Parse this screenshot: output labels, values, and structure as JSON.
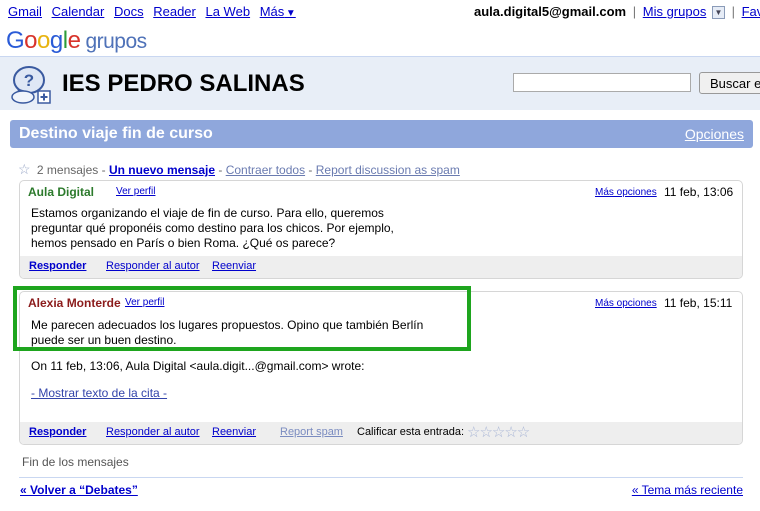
{
  "topnav": {
    "links": [
      "Gmail",
      "Calendar",
      "Docs",
      "Reader",
      "La Web",
      "Más"
    ],
    "more_caret": "▼",
    "user_email": "aula.digital5@gmail.com",
    "sep": "|",
    "mis_grupos": "Mis grupos",
    "dropdown_glyph": "▼",
    "favoritos": "Favo"
  },
  "logo": {
    "letters": [
      "G",
      "o",
      "o",
      "g",
      "l",
      "e"
    ],
    "product": "grupos"
  },
  "group": {
    "title": "IES PEDRO SALINAS",
    "search_placeholder": "",
    "search_button": "Buscar e"
  },
  "topic": {
    "title": "Destino viaje fin de curso",
    "options": "Opciones"
  },
  "actions": {
    "star_glyph": "☆",
    "count": "2 mensajes",
    "sep": "-",
    "new_message": "Un nuevo mensaje",
    "collapse_all": "Contraer todos",
    "report_spam": "Report discussion as spam"
  },
  "messages": [
    {
      "author": "Aula Digital",
      "ver_perfil": "Ver perfil",
      "mas_opciones": "Más opciones",
      "date": "11 feb, 13:06",
      "body_lines": [
        "Estamos organizando el viaje de fin de curso. Para ello, queremos",
        "preguntar qué proponéis como destino para los chicos. Por ejemplo,",
        "hemos pensado en París o bien Roma. ¿Qué os parece?"
      ],
      "footer": {
        "reply": "Responder",
        "reply_author": "Responder al autor",
        "forward": "Reenviar"
      }
    },
    {
      "author": "Alexia Monterde",
      "ver_perfil": "Ver perfil",
      "mas_opciones": "Más opciones",
      "date": "11 feb, 15:11",
      "body_lines": [
        "Me parecen adecuados los lugares propuestos. Opino que también Berlín",
        "puede ser un buen destino."
      ],
      "quote_header": "On 11 feb, 13:06, Aula Digital <aula.digit...@gmail.com> wrote:",
      "show_quote": "- Mostrar texto de la cita -",
      "footer": {
        "reply": "Responder",
        "reply_author": "Responder al autor",
        "forward": "Reenviar",
        "report_spam": "Report spam",
        "rate_label": "Calificar esta entrada:",
        "stars": "☆☆☆☆☆",
        "rating": 0
      }
    }
  ],
  "end_of_messages": "Fin de los mensajes",
  "bottom": {
    "back": "« Volver a “Debates”",
    "recent": "« Tema más reciente"
  },
  "colors": {
    "topic_bar": "#8fa7dc",
    "group_header": "#e8eef7",
    "highlight": "#1ea51e"
  }
}
